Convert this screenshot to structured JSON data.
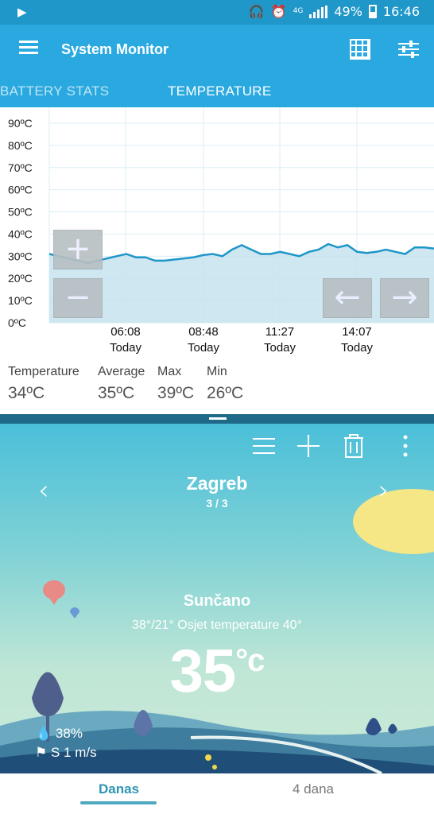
{
  "status_bar": {
    "play_icon": "play-icon",
    "network": "4G",
    "battery": "49%",
    "time": "16:46"
  },
  "app_bar": {
    "title": "System Monitor"
  },
  "tabs": [
    {
      "label": "BATTERY STATS",
      "active": false
    },
    {
      "label": "TEMPERATURE",
      "active": true
    }
  ],
  "chart_data": {
    "type": "area",
    "y_ticks": [
      "90ºC",
      "80ºC",
      "70ºC",
      "60ºC",
      "50ºC",
      "40ºC",
      "30ºC",
      "20ºC",
      "10ºC",
      "0ºC"
    ],
    "ylim": [
      0,
      90
    ],
    "x_ticks": [
      {
        "time": "06:08",
        "day": "Today"
      },
      {
        "time": "08:48",
        "day": "Today"
      },
      {
        "time": "11:27",
        "day": "Today"
      },
      {
        "time": "14:07",
        "day": "Today"
      }
    ],
    "series": [
      {
        "color": "#1e96c8",
        "fill": "#c6e3ef",
        "values": [
          31,
          30,
          29,
          28,
          27,
          28,
          29,
          30,
          31,
          29.5,
          29.5,
          28,
          28,
          28.5,
          29,
          29.5,
          30.5,
          31,
          30,
          33,
          35,
          33,
          31,
          31,
          32,
          31,
          30,
          32,
          33,
          35.5,
          34,
          35,
          32,
          31.5,
          32,
          33,
          32,
          31,
          34,
          34,
          33.5
        ]
      }
    ],
    "grid": true
  },
  "stats": [
    {
      "label": "Temperature",
      "value": "34ºC"
    },
    {
      "label": "Average",
      "value": "35ºC"
    },
    {
      "label": "Max",
      "value": "39ºC"
    },
    {
      "label": "Min",
      "value": "26ºC"
    }
  ],
  "weather": {
    "city": "Zagreb",
    "page": "3 / 3",
    "condition": "Sunčano",
    "feels_like": "38°/21° Osjet temperature 40°",
    "temperature": "35",
    "unit": "°c",
    "humidity": "38%",
    "wind": "S 1 m/s"
  },
  "bottom_tabs": [
    {
      "label": "Danas",
      "active": true
    },
    {
      "label": "4 dana",
      "active": false
    }
  ],
  "colors": {
    "app_bar": "#2aa9e0",
    "status_bar": "#1f97c9",
    "chart_line": "#1e96c8",
    "chart_fill": "#c6e3ef",
    "active_tab": "#2d95b3",
    "sun": "#f5e686"
  }
}
